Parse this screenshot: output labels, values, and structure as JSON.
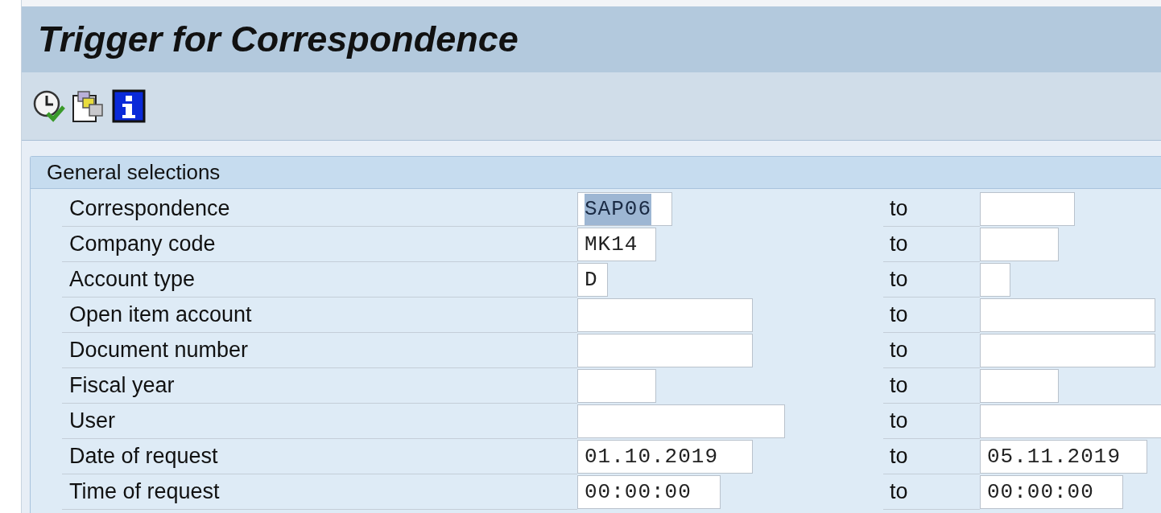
{
  "window": {
    "title": "Trigger for Correspondence"
  },
  "toolbar": [
    {
      "kind": "execute"
    },
    {
      "kind": "variants"
    },
    {
      "kind": "info"
    }
  ],
  "section": {
    "title": "General selections",
    "rows": [
      {
        "label": "Correspondence",
        "from": {
          "value": "SAP06",
          "selected": true
        },
        "to_label": "to"
      },
      {
        "label": "Company code",
        "from": {
          "value": "MK14"
        },
        "to_label": "to"
      },
      {
        "label": "Account type",
        "from": {
          "value": "D"
        },
        "to_label": "to"
      },
      {
        "label": "Open item account",
        "to_label": "to"
      },
      {
        "label": "Document number",
        "to_label": "to"
      },
      {
        "label": "Fiscal year",
        "to_label": "to"
      },
      {
        "label": "User",
        "to_label": "to"
      },
      {
        "label": "Date of request",
        "from": {
          "value": "01.10.2019"
        },
        "to_label": "to",
        "to": {
          "value": "05.11.2019"
        }
      },
      {
        "label": "Time of request",
        "from": {
          "value": "00:00:00"
        },
        "to_label": "to",
        "to": {
          "value": "00:00:00"
        }
      }
    ]
  }
}
